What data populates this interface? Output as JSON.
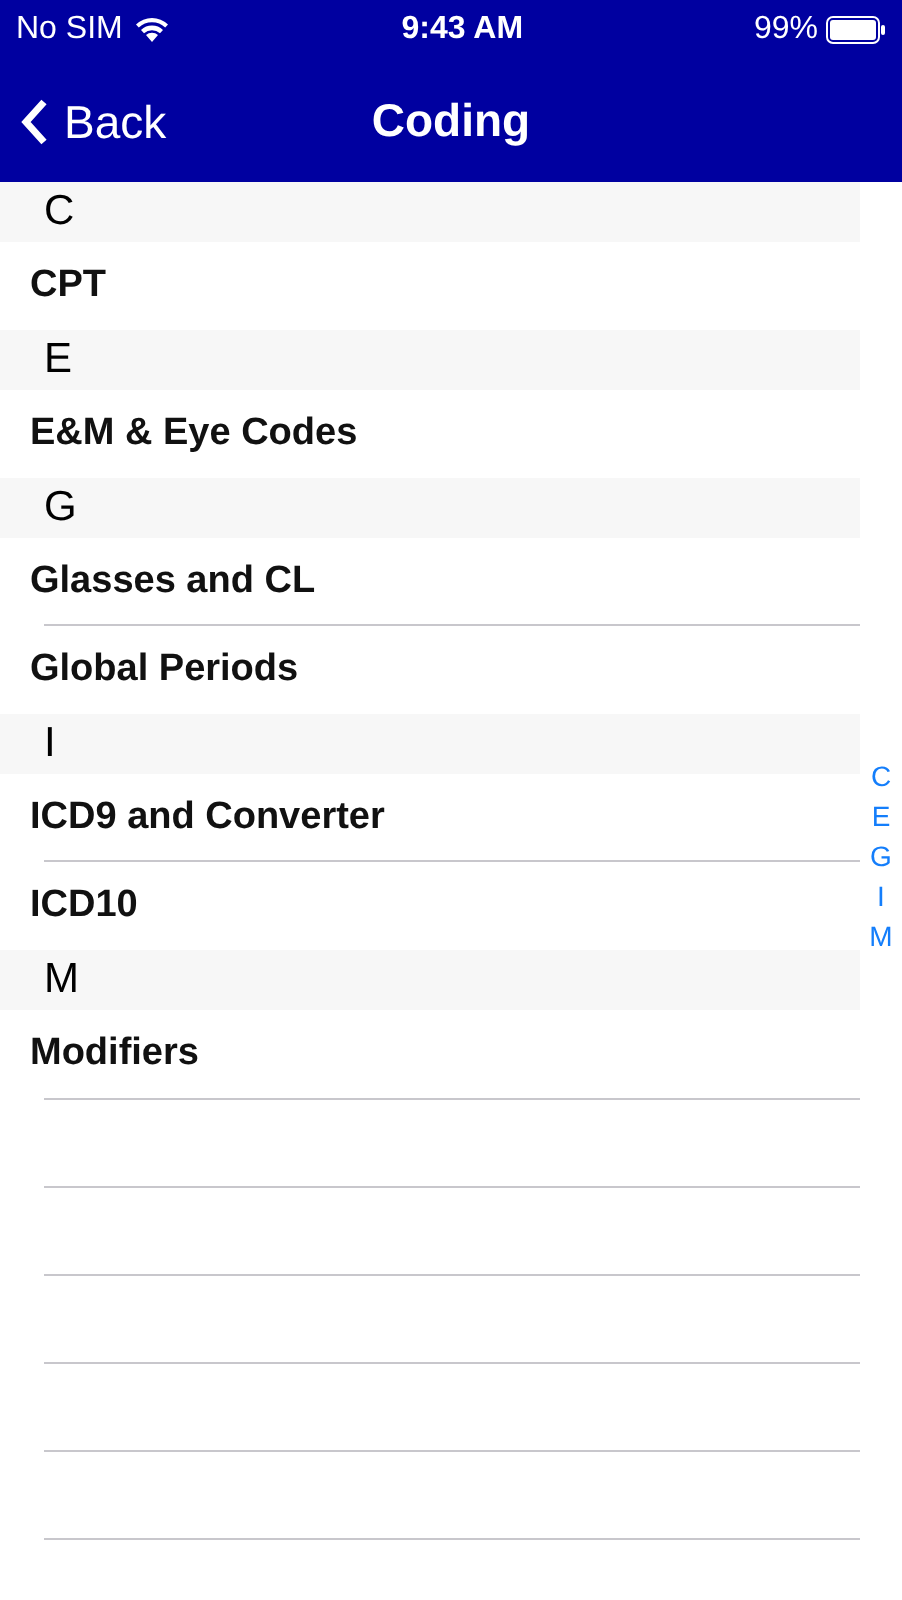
{
  "status_bar": {
    "carrier": "No SIM",
    "time": "9:43 AM",
    "battery": "99%"
  },
  "nav": {
    "back": "Back",
    "title": "Coding"
  },
  "sections": [
    {
      "header": "C",
      "items": [
        "CPT"
      ]
    },
    {
      "header": "E",
      "items": [
        "E&M & Eye Codes"
      ]
    },
    {
      "header": "G",
      "items": [
        "Glasses and CL",
        "Global Periods"
      ]
    },
    {
      "header": "I",
      "items": [
        "ICD9 and Converter",
        "ICD10"
      ]
    },
    {
      "header": "M",
      "items": [
        "Modifiers"
      ]
    }
  ],
  "index": [
    "C",
    "E",
    "G",
    "I",
    "M"
  ]
}
